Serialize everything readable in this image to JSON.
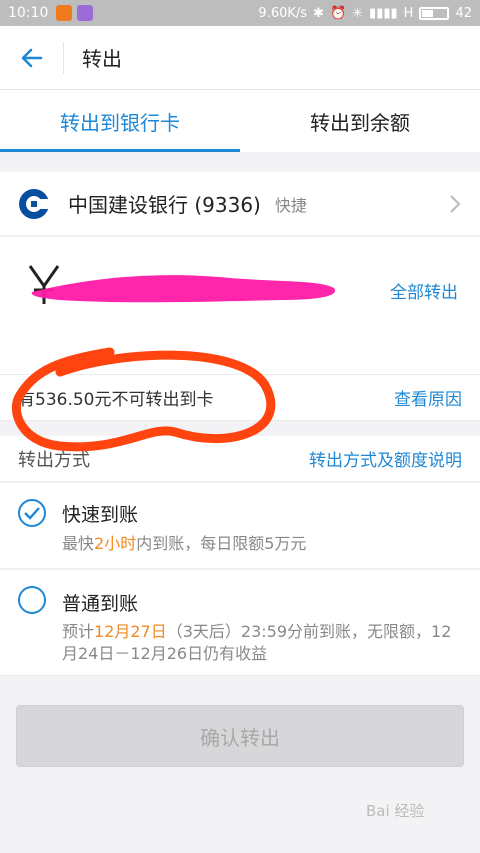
{
  "status_bar": {
    "time": "10:10",
    "speed": "9.60K/s",
    "network": "H",
    "battery": "42"
  },
  "header": {
    "title": "转出"
  },
  "tabs": [
    {
      "label": "转出到银行卡",
      "active": true
    },
    {
      "label": "转出到余额",
      "active": false
    }
  ],
  "bank": {
    "name": "中国建设银行 (9336)",
    "tag": "快捷"
  },
  "amount": {
    "currency_symbol": "¥",
    "placeholder": "",
    "all_out_label": "全部转出"
  },
  "notice": {
    "text": "有536.50元不可转出到卡",
    "link": "查看原因"
  },
  "method": {
    "label": "转出方式",
    "link": "转出方式及额度说明"
  },
  "options": {
    "fast": {
      "title": "快速到账",
      "desc_pre": "最快",
      "desc_hl": "2小时",
      "desc_post": "内到账，每日限额5万元"
    },
    "normal": {
      "title": "普通到账",
      "desc_pre": "预计",
      "desc_hl": "12月27日",
      "desc_post": "（3天后）23:59分前到账，无限额，12月24日－12月26日仍有收益"
    }
  },
  "confirm_label": "确认转出",
  "watermark": "Bai 经验",
  "colors": {
    "accent": "#1e88d6",
    "highlight": "#f08a22",
    "scribble_pink": "#ff1493",
    "scribble_orange": "#ff4a1a"
  }
}
